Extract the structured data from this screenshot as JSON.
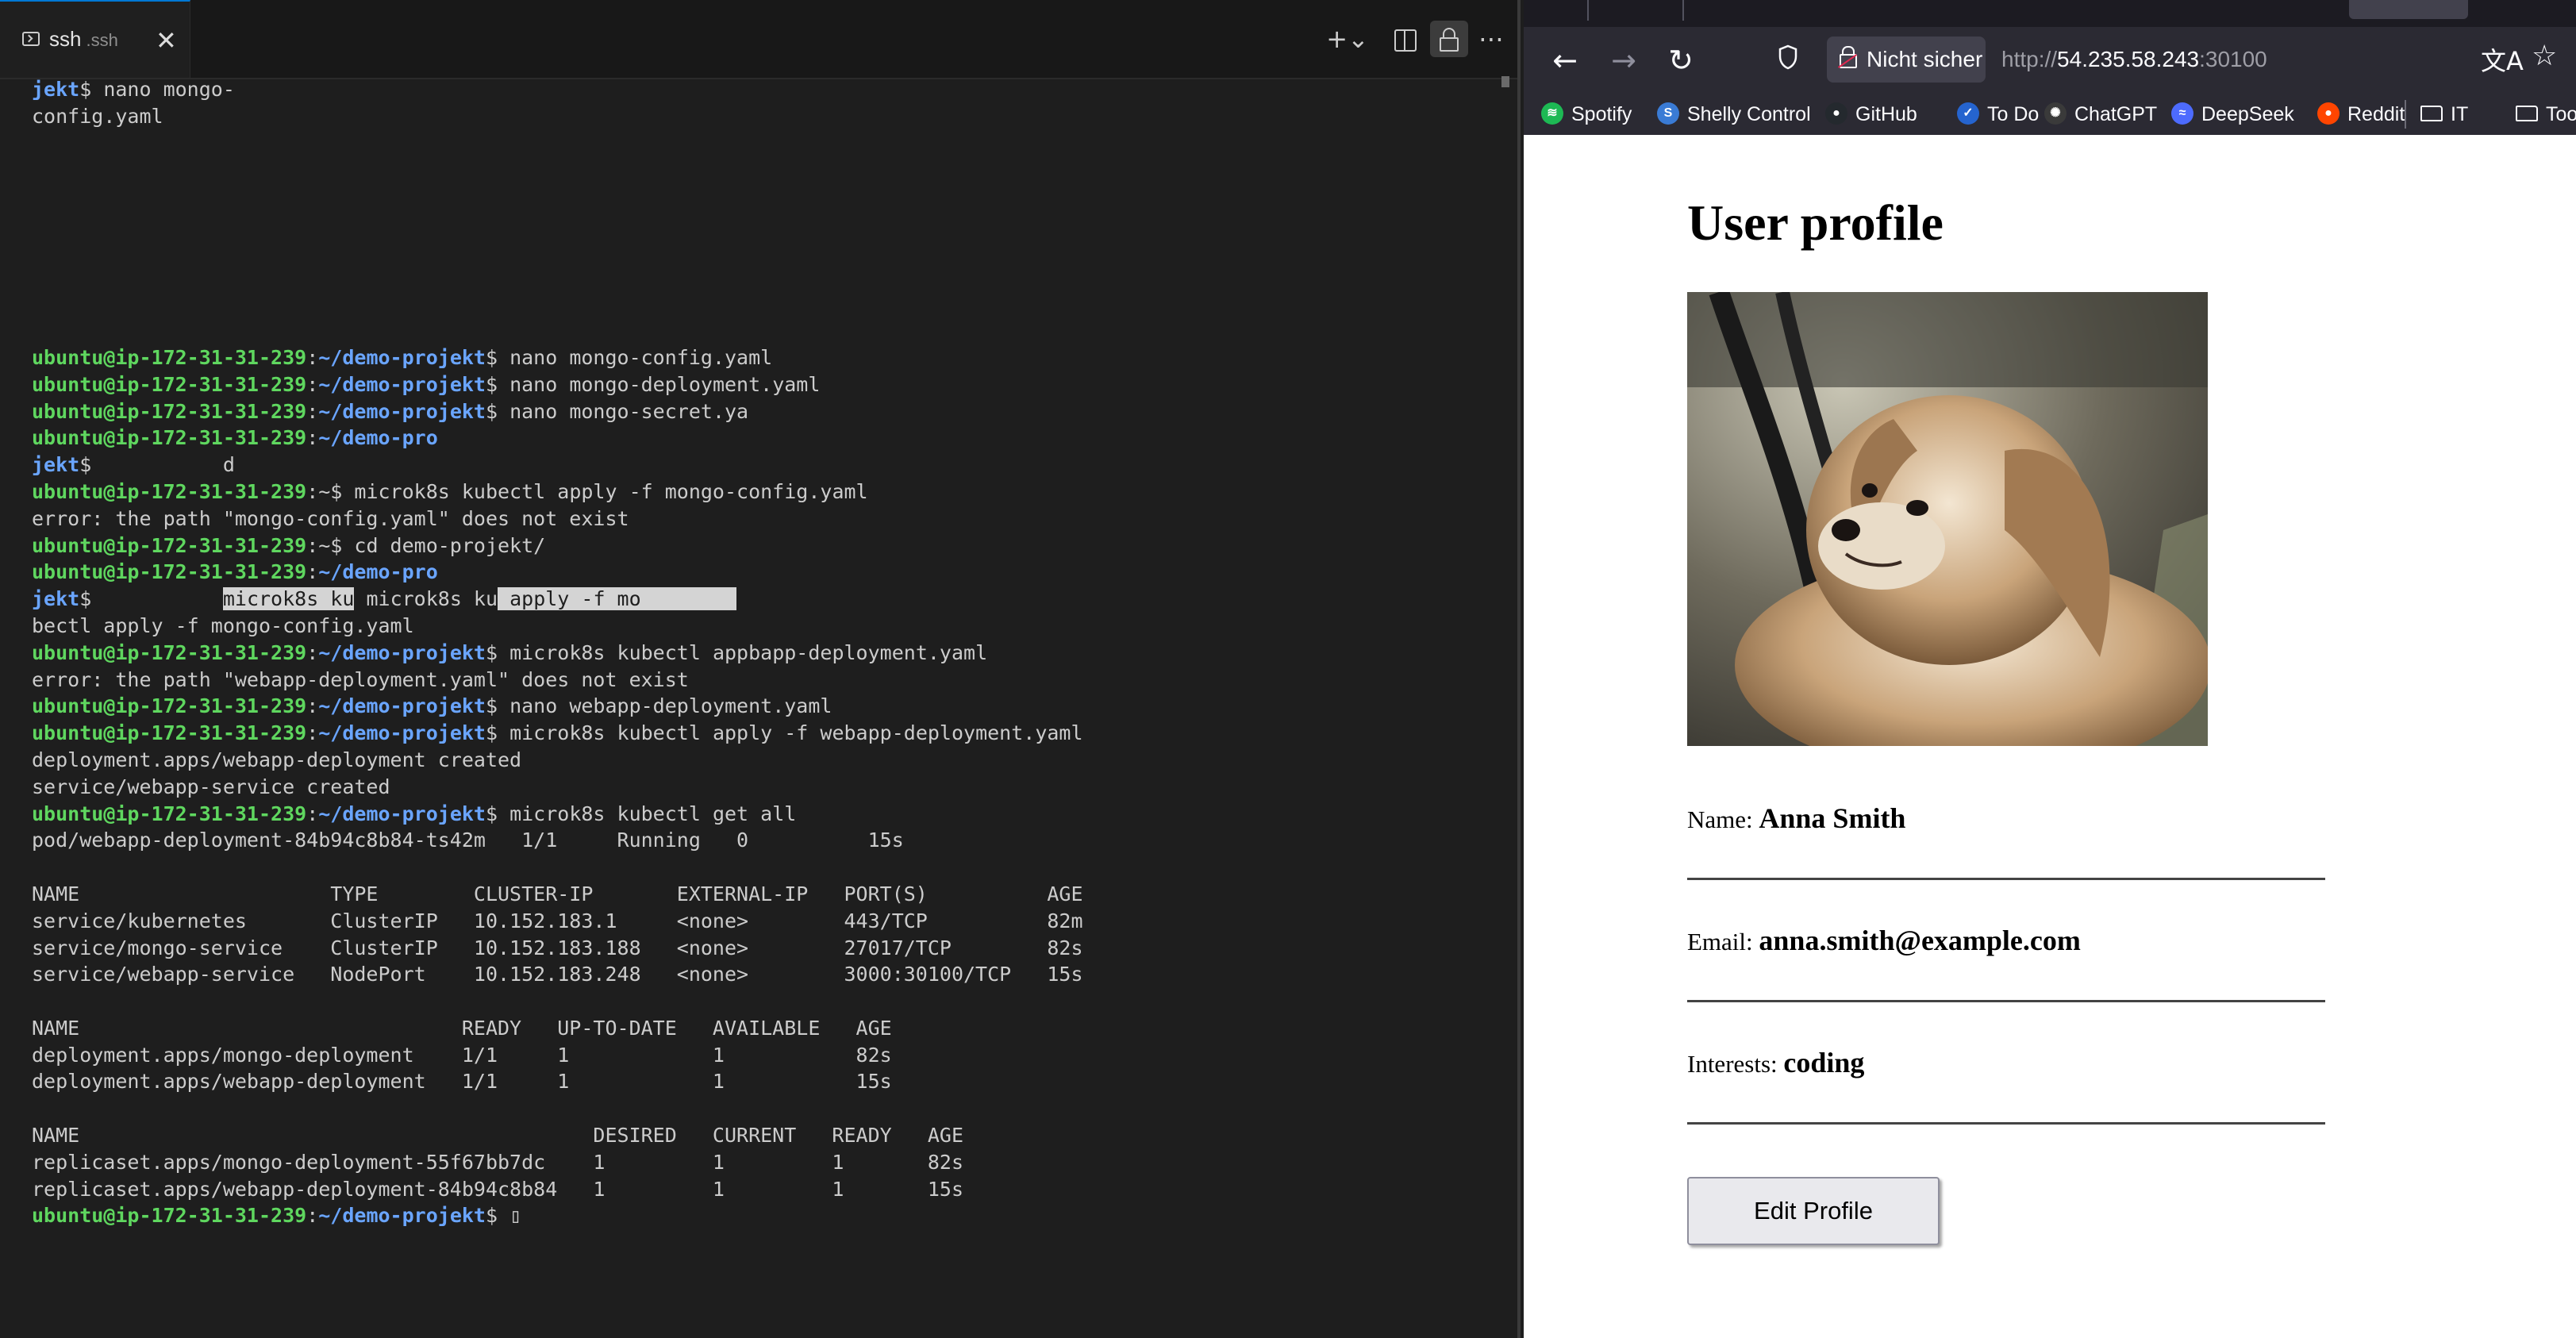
{
  "terminal": {
    "tab_title": "ssh",
    "tab_subtitle": ".ssh",
    "close_symbol": "✕",
    "toolbar": {
      "new_label": "+⌄",
      "more_label": "⋯"
    },
    "lines": [
      [
        {
          "t": "jekt",
          "c": "p"
        },
        {
          "t": "$ nano mongo-"
        }
      ],
      [
        {
          "t": "config.yaml"
        }
      ],
      [],
      [],
      [],
      [],
      [],
      [],
      [],
      [],
      [
        {
          "t": "ubuntu@ip-172-31-31-239",
          "c": "u"
        },
        {
          "t": ":"
        },
        {
          "t": "~/demo-projekt",
          "c": "p"
        },
        {
          "t": "$ nano mongo-config.yaml"
        }
      ],
      [
        {
          "t": "ubuntu@ip-172-31-31-239",
          "c": "u"
        },
        {
          "t": ":"
        },
        {
          "t": "~/demo-projekt",
          "c": "p"
        },
        {
          "t": "$ nano mongo-deployment.yaml"
        }
      ],
      [
        {
          "t": "ubuntu@ip-172-31-31-239",
          "c": "u"
        },
        {
          "t": ":"
        },
        {
          "t": "~/demo-projekt",
          "c": "p"
        },
        {
          "t": "$ nano mongo-secret.ya"
        }
      ],
      [
        {
          "t": "ubuntu@ip-172-31-31-239",
          "c": "u"
        },
        {
          "t": ":"
        },
        {
          "t": "~/demo-pro",
          "c": "p"
        }
      ],
      [
        {
          "t": "jekt",
          "c": "p"
        },
        {
          "t": "$           d"
        }
      ],
      [
        {
          "t": "ubuntu@ip-172-31-31-239",
          "c": "u"
        },
        {
          "t": ":~$ microk8s kubectl apply -f mongo-config.yaml"
        }
      ],
      [
        {
          "t": "error: the path \"mongo-config.yaml\" does not exist"
        }
      ],
      [
        {
          "t": "ubuntu@ip-172-31-31-239",
          "c": "u"
        },
        {
          "t": ":~$ cd demo-projekt/"
        }
      ],
      [
        {
          "t": "ubuntu@ip-172-31-31-239",
          "c": "u"
        },
        {
          "t": ":"
        },
        {
          "t": "~/demo-pro",
          "c": "p"
        }
      ],
      [
        {
          "t": "jekt",
          "c": "p"
        },
        {
          "t": "$           "
        },
        {
          "t": "microk8s ku",
          "c": "sel"
        },
        {
          "t": " microk8s ku"
        },
        {
          "t": " apply -f mo        ",
          "c": "sel"
        }
      ],
      [
        {
          "t": "bectl apply -f mongo-config.yaml"
        }
      ],
      [
        {
          "t": "ubuntu@ip-172-31-31-239",
          "c": "u"
        },
        {
          "t": ":"
        },
        {
          "t": "~/demo-projekt",
          "c": "p"
        },
        {
          "t": "$ microk8s kubectl appbapp-deployment.yaml"
        }
      ],
      [
        {
          "t": "error: the path \"webapp-deployment.yaml\" does not exist"
        }
      ],
      [
        {
          "t": "ubuntu@ip-172-31-31-239",
          "c": "u"
        },
        {
          "t": ":"
        },
        {
          "t": "~/demo-projekt",
          "c": "p"
        },
        {
          "t": "$ nano webapp-deployment.yaml"
        }
      ],
      [
        {
          "t": "ubuntu@ip-172-31-31-239",
          "c": "u"
        },
        {
          "t": ":"
        },
        {
          "t": "~/demo-projekt",
          "c": "p"
        },
        {
          "t": "$ microk8s kubectl apply -f webapp-deployment.yaml"
        }
      ],
      [
        {
          "t": "deployment.apps/webapp-deployment created"
        }
      ],
      [
        {
          "t": "service/webapp-service created"
        }
      ],
      [
        {
          "t": "ubuntu@ip-172-31-31-239",
          "c": "u"
        },
        {
          "t": ":"
        },
        {
          "t": "~/demo-projekt",
          "c": "p"
        },
        {
          "t": "$ microk8s kubectl get all"
        }
      ],
      [
        {
          "t": "pod/webapp-deployment-84b94c8b84-ts42m   1/1     Running   0          15s"
        }
      ],
      [],
      [
        {
          "t": "NAME                     TYPE        CLUSTER-IP       EXTERNAL-IP   PORT(S)          AGE"
        }
      ],
      [
        {
          "t": "service/kubernetes       ClusterIP   10.152.183.1     <none>        443/TCP          82m"
        }
      ],
      [
        {
          "t": "service/mongo-service    ClusterIP   10.152.183.188   <none>        27017/TCP        82s"
        }
      ],
      [
        {
          "t": "service/webapp-service   NodePort    10.152.183.248   <none>        3000:30100/TCP   15s"
        }
      ],
      [],
      [
        {
          "t": "NAME                                READY   UP-TO-DATE   AVAILABLE   AGE"
        }
      ],
      [
        {
          "t": "deployment.apps/mongo-deployment    1/1     1            1           82s"
        }
      ],
      [
        {
          "t": "deployment.apps/webapp-deployment   1/1     1            1           15s"
        }
      ],
      [],
      [
        {
          "t": "NAME                                           DESIRED   CURRENT   READY   AGE"
        }
      ],
      [
        {
          "t": "replicaset.apps/mongo-deployment-55f67bb7dc    1         1         1       82s"
        }
      ],
      [
        {
          "t": "replicaset.apps/webapp-deployment-84b94c8b84   1         1         1       15s"
        }
      ],
      [
        {
          "t": "ubuntu@ip-172-31-31-239",
          "c": "u"
        },
        {
          "t": ":"
        },
        {
          "t": "~/demo-projekt",
          "c": "p"
        },
        {
          "t": "$ "
        },
        {
          "t": "▯"
        }
      ]
    ]
  },
  "browser": {
    "nav": {
      "back": "←",
      "forward": "→",
      "reload": "↻"
    },
    "security_label": "Nicht sicher",
    "url_prefix": "http://",
    "url_host": "54.235.58.243",
    "url_port": ":30100",
    "translate_icon": "文A",
    "star_icon": "☆",
    "bookmarks": [
      {
        "label": "Spotify",
        "icon": "spotify-icon",
        "color": "#1db954",
        "glyph": "≋"
      },
      {
        "label": "Shelly Control",
        "icon": "shelly-icon",
        "color": "#3a7bd5",
        "glyph": "S"
      },
      {
        "label": "GitHub",
        "icon": "github-icon",
        "color": "#24292e",
        "glyph": "●"
      },
      {
        "label": "To Do",
        "icon": "todo-icon",
        "color": "#2564cf",
        "glyph": "✓"
      },
      {
        "label": "ChatGPT",
        "icon": "chatgpt-icon",
        "color": "#3a3a3a",
        "glyph": "✺"
      },
      {
        "label": "DeepSeek",
        "icon": "deepseek-icon",
        "color": "#4d6bfe",
        "glyph": "≈"
      },
      {
        "label": "Reddit",
        "icon": "reddit-icon",
        "color": "#ff4500",
        "glyph": "●"
      },
      {
        "label": "IT",
        "icon": "folder-icon",
        "folder": true
      },
      {
        "label": "Tools",
        "icon": "folder-icon",
        "folder": true
      }
    ],
    "page": {
      "title": "User profile",
      "name_label": "Name:",
      "name_value": "Anna Smith",
      "email_label": "Email:",
      "email_value": "anna.smith@example.com",
      "interests_label": "Interests:",
      "interests_value": "coding",
      "edit_button": "Edit Profile"
    }
  }
}
